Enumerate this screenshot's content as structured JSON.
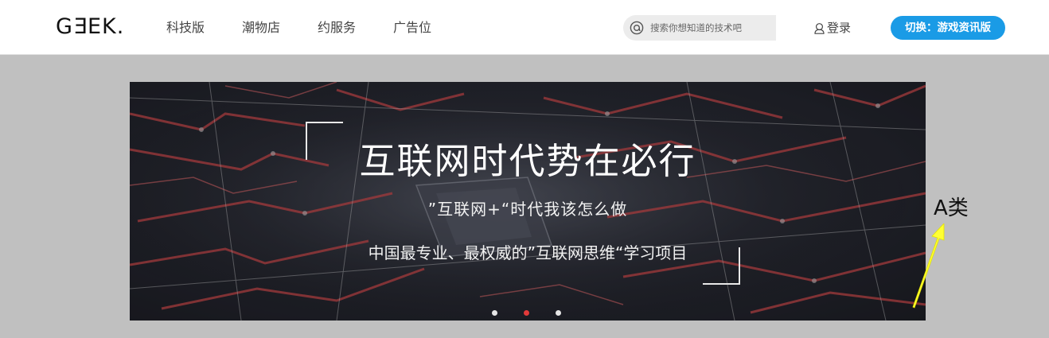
{
  "header": {
    "logo_text_1": "G",
    "logo_text_2": "E",
    "logo_text_3": "EK.",
    "nav": [
      {
        "label": "科技版"
      },
      {
        "label": "潮物店"
      },
      {
        "label": "约服务"
      },
      {
        "label": "广告位"
      }
    ],
    "search": {
      "placeholder": "搜索你想知道的技术吧",
      "icon": "search-icon"
    },
    "login": {
      "label": "登录",
      "icon": "user-icon"
    },
    "switch_button": "切换：游戏资讯版"
  },
  "banner": {
    "title": "互联网时代势在必行",
    "subtitle_1": "”互联网+“时代我该怎么做",
    "subtitle_2": "中国最专业、最权威的”互联网思维“学习项目",
    "dots_count": 3,
    "active_dot": 2
  },
  "annotation": {
    "label": "A类",
    "arrow_color": "#ffff33"
  },
  "colors": {
    "accent_blue": "#1a9be6",
    "active_dot": "#e23a3a",
    "page_gray": "#c0c0c0"
  }
}
